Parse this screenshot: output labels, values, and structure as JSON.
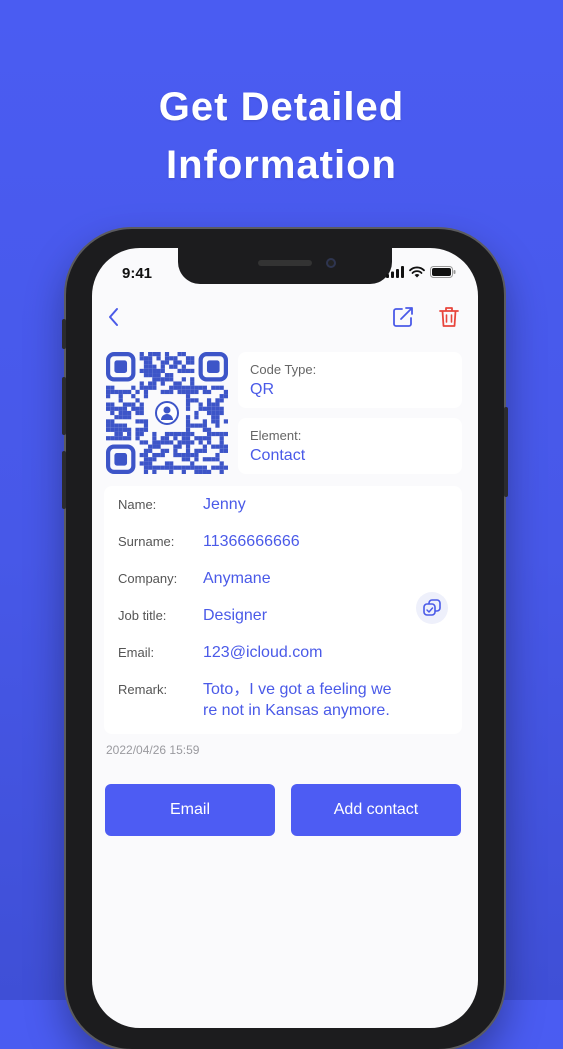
{
  "headline": {
    "line1": "Get Detailed",
    "line2": "Information"
  },
  "status_bar": {
    "time": "9:41"
  },
  "code_info": {
    "type_label": "Code Type:",
    "type_value": "QR",
    "element_label": "Element:",
    "element_value": "Contact"
  },
  "contact": {
    "fields": [
      {
        "label": "Name:",
        "value": "Jenny"
      },
      {
        "label": "Surname:",
        "value": "11366666666"
      },
      {
        "label": "Company:",
        "value": "Anymane"
      },
      {
        "label": "Job title:",
        "value": "Designer"
      },
      {
        "label": "Email:",
        "value": "123@icloud.com"
      },
      {
        "label": "Remark:",
        "value_line1": "Toto，I ve got a feeling we",
        "value_line2": "re not in Kansas anymore."
      }
    ]
  },
  "timestamp": "2022/04/26 15:59",
  "actions": {
    "email_label": "Email",
    "add_contact_label": "Add contact"
  },
  "colors": {
    "accent": "#4d5cf3",
    "background": "#4a5cf2",
    "delete": "#e8453c"
  },
  "icons": [
    "back-chevron-icon",
    "share-icon",
    "trash-icon",
    "copy-icon",
    "user-icon",
    "signal-icon",
    "wifi-icon",
    "battery-icon"
  ]
}
